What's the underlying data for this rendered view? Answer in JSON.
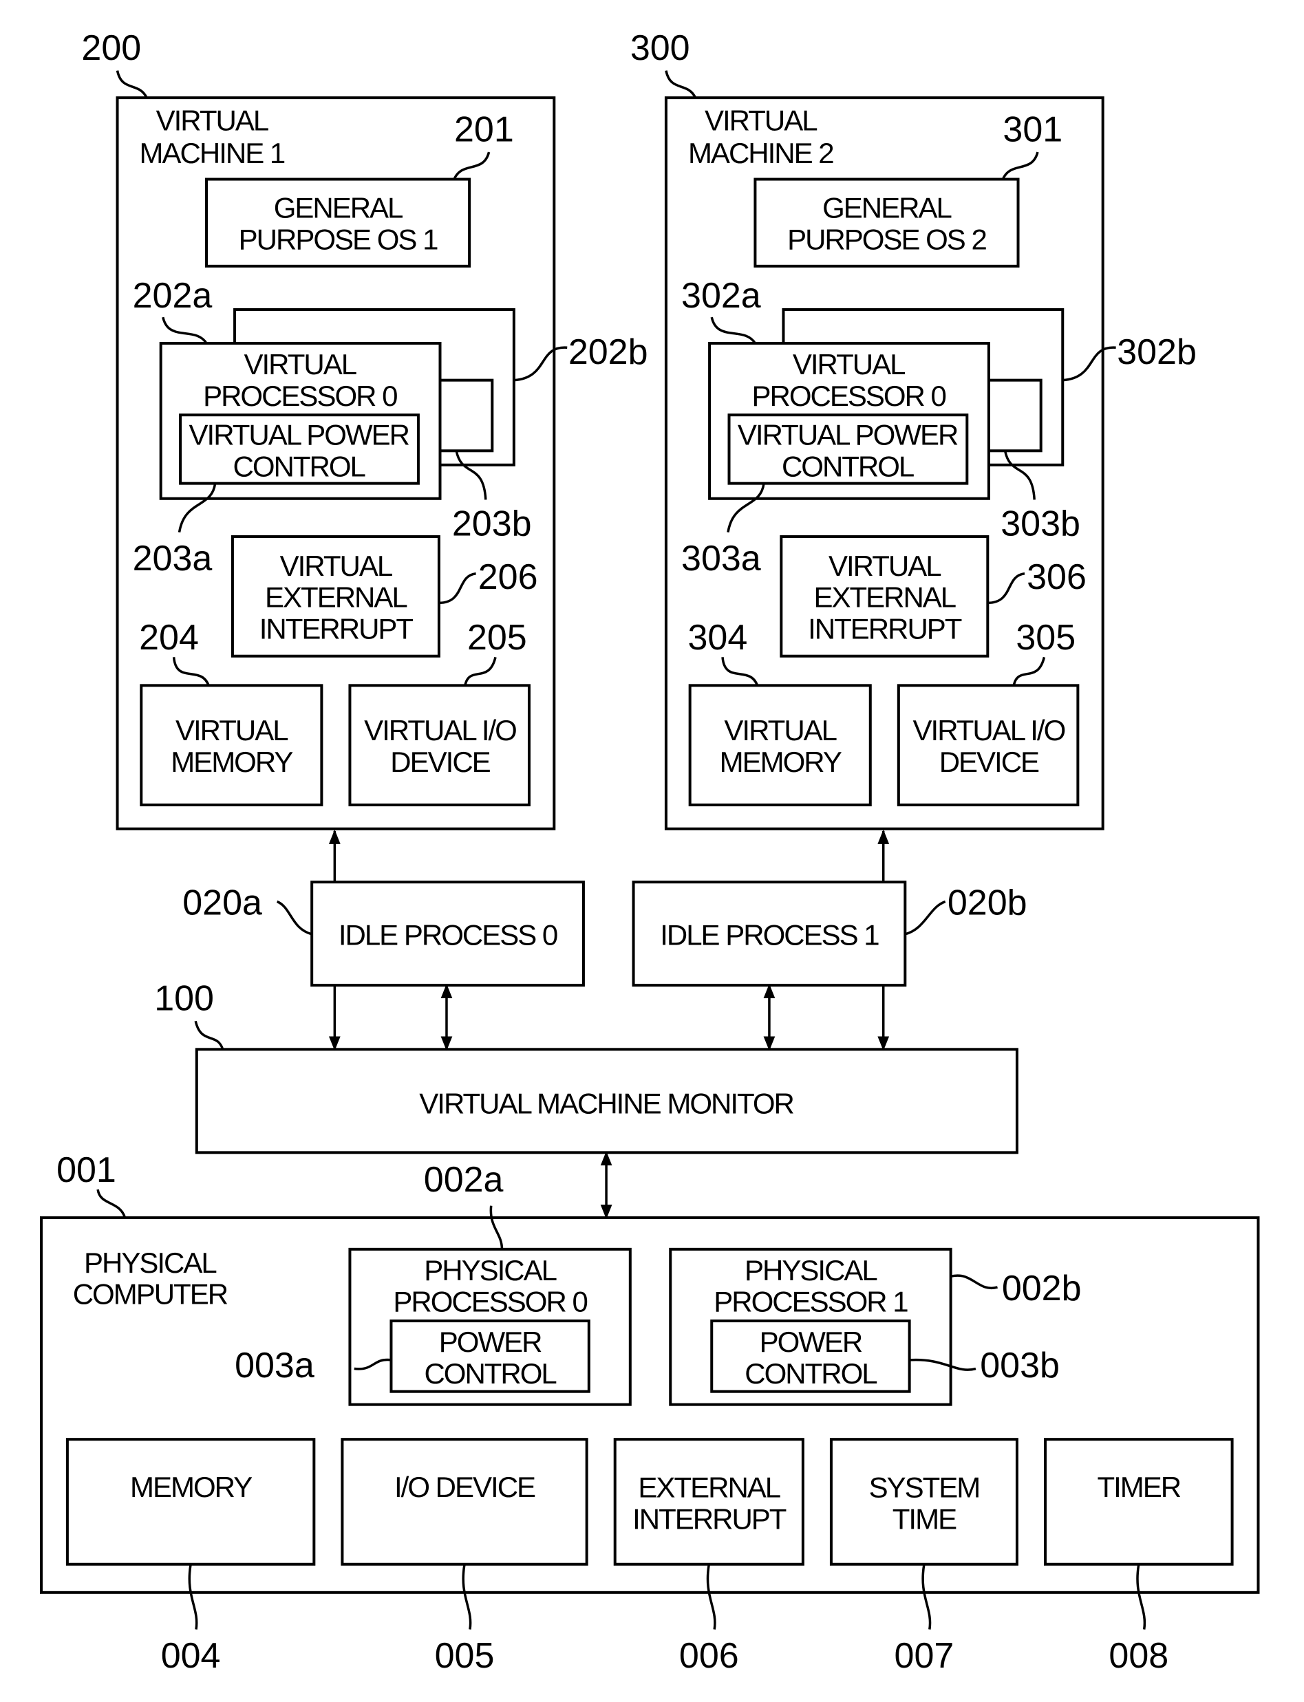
{
  "figure": {
    "virtual_machines": [
      {
        "ref": "200",
        "title": [
          "VIRTUAL",
          "MACHINE 1"
        ],
        "os": {
          "ref": "201",
          "lines": [
            "GENERAL",
            "PURPOSE OS 1"
          ]
        },
        "vp_front_ref": "202a",
        "vp_back_ref": "202b",
        "vp_lines": [
          "VIRTUAL",
          "PROCESSOR 0"
        ],
        "vpc_front_ref": "203a",
        "vpc_back_ref": "203b",
        "vpc_lines": [
          "VIRTUAL POWER",
          "CONTROL"
        ],
        "vei": {
          "ref": "206",
          "lines": [
            "VIRTUAL",
            "EXTERNAL",
            "INTERRUPT"
          ]
        },
        "vmem": {
          "ref": "204",
          "lines": [
            "VIRTUAL",
            "MEMORY"
          ]
        },
        "vio": {
          "ref": "205",
          "lines": [
            "VIRTUAL I/O",
            "DEVICE"
          ]
        }
      },
      {
        "ref": "300",
        "title": [
          "VIRTUAL",
          "MACHINE 2"
        ],
        "os": {
          "ref": "301",
          "lines": [
            "GENERAL",
            "PURPOSE OS 2"
          ]
        },
        "vp_front_ref": "302a",
        "vp_back_ref": "302b",
        "vp_lines": [
          "VIRTUAL",
          "PROCESSOR 0"
        ],
        "vpc_front_ref": "303a",
        "vpc_back_ref": "303b",
        "vpc_lines": [
          "VIRTUAL POWER",
          "CONTROL"
        ],
        "vei": {
          "ref": "306",
          "lines": [
            "VIRTUAL",
            "EXTERNAL",
            "INTERRUPT"
          ]
        },
        "vmem": {
          "ref": "304",
          "lines": [
            "VIRTUAL",
            "MEMORY"
          ]
        },
        "vio": {
          "ref": "305",
          "lines": [
            "VIRTUAL I/O",
            "DEVICE"
          ]
        }
      }
    ],
    "idle_processes": [
      {
        "ref": "020a",
        "label": "IDLE PROCESS 0"
      },
      {
        "ref": "020b",
        "label": "IDLE PROCESS 1"
      }
    ],
    "vmm": {
      "ref": "100",
      "label": "VIRTUAL MACHINE MONITOR"
    },
    "physical": {
      "ref": "001",
      "title": [
        "PHYSICAL",
        "COMPUTER"
      ],
      "processors": [
        {
          "ref": "002a",
          "lines": [
            "PHYSICAL",
            "PROCESSOR 0"
          ],
          "pc_ref": "003a",
          "pc_lines": [
            "POWER",
            "CONTROL"
          ]
        },
        {
          "ref": "002b",
          "lines": [
            "PHYSICAL",
            "PROCESSOR 1"
          ],
          "pc_ref": "003b",
          "pc_lines": [
            "POWER",
            "CONTROL"
          ]
        }
      ],
      "components": [
        {
          "ref": "004",
          "lines": [
            "MEMORY"
          ]
        },
        {
          "ref": "005",
          "lines": [
            "I/O DEVICE"
          ]
        },
        {
          "ref": "006",
          "lines": [
            "EXTERNAL",
            "INTERRUPT"
          ]
        },
        {
          "ref": "007",
          "lines": [
            "SYSTEM",
            "TIME"
          ]
        },
        {
          "ref": "008",
          "lines": [
            "TIMER"
          ]
        }
      ]
    }
  }
}
